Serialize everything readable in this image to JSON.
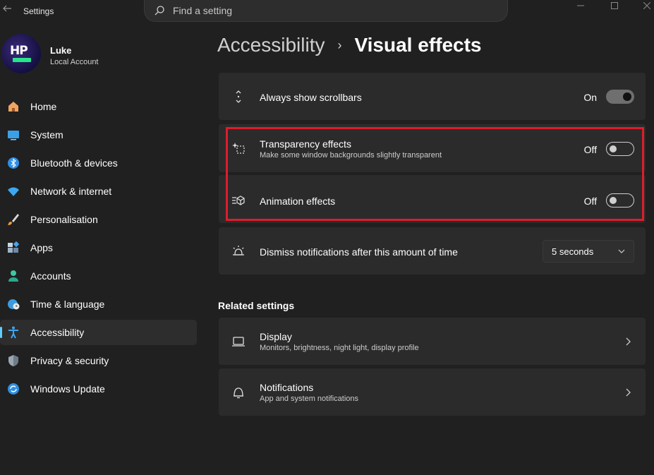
{
  "window": {
    "title": "Settings",
    "search_placeholder": "Find a setting"
  },
  "profile": {
    "name": "Luke",
    "account_type": "Local Account",
    "avatar_text": "HP"
  },
  "sidebar": {
    "items": [
      {
        "label": "Home",
        "icon": "home-icon"
      },
      {
        "label": "System",
        "icon": "system-icon"
      },
      {
        "label": "Bluetooth & devices",
        "icon": "bluetooth-icon"
      },
      {
        "label": "Network & internet",
        "icon": "wifi-icon"
      },
      {
        "label": "Personalisation",
        "icon": "brush-icon"
      },
      {
        "label": "Apps",
        "icon": "apps-icon"
      },
      {
        "label": "Accounts",
        "icon": "person-icon"
      },
      {
        "label": "Time & language",
        "icon": "globe-clock-icon"
      },
      {
        "label": "Accessibility",
        "icon": "accessibility-icon",
        "active": true
      },
      {
        "label": "Privacy & security",
        "icon": "shield-icon"
      },
      {
        "label": "Windows Update",
        "icon": "update-icon"
      }
    ]
  },
  "header": {
    "parent": "Accessibility",
    "separator": "›",
    "current": "Visual effects"
  },
  "settings": {
    "scrollbars": {
      "title": "Always show scrollbars",
      "state": "On",
      "enabled": true
    },
    "transparency": {
      "title": "Transparency effects",
      "subtitle": "Make some window backgrounds slightly transparent",
      "state": "Off",
      "enabled": false
    },
    "animation": {
      "title": "Animation effects",
      "state": "Off",
      "enabled": false
    },
    "notifications_timeout": {
      "title": "Dismiss notifications after this amount of time",
      "value": "5 seconds"
    }
  },
  "related": {
    "heading": "Related settings",
    "display": {
      "title": "Display",
      "subtitle": "Monitors, brightness, night light, display profile"
    },
    "notifications": {
      "title": "Notifications",
      "subtitle": "App and system notifications"
    }
  },
  "colors": {
    "background": "#202020",
    "card": "#2b2b2b",
    "accent": "#60cdff",
    "highlight_border": "#e01c2a"
  }
}
